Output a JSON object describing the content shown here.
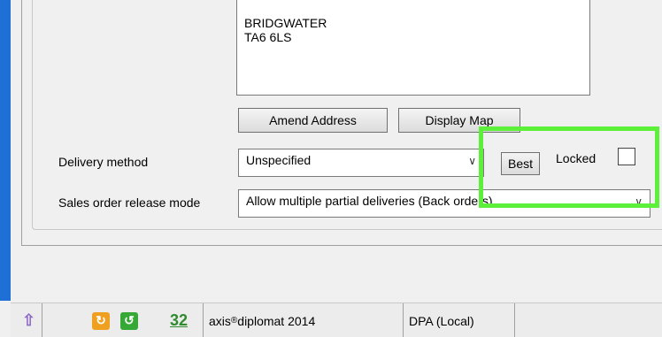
{
  "address": {
    "lines": [
      "BRIDGWATER",
      "TA6 6LS"
    ]
  },
  "buttons": {
    "amend_address": "Amend Address",
    "display_map": "Display Map",
    "best": "Best"
  },
  "delivery": {
    "label": "Delivery method",
    "value": "Unspecified"
  },
  "release": {
    "label": "Sales order release mode",
    "value": "Allow multiple partial deliveries (Back orders)"
  },
  "locked": {
    "label": "Locked",
    "checked": false
  },
  "highlight_color": "#5cf03a",
  "statusbar": {
    "count": "32",
    "product": "axis",
    "product_rest": " diplomat 2014",
    "database": "DPA (Local)"
  }
}
